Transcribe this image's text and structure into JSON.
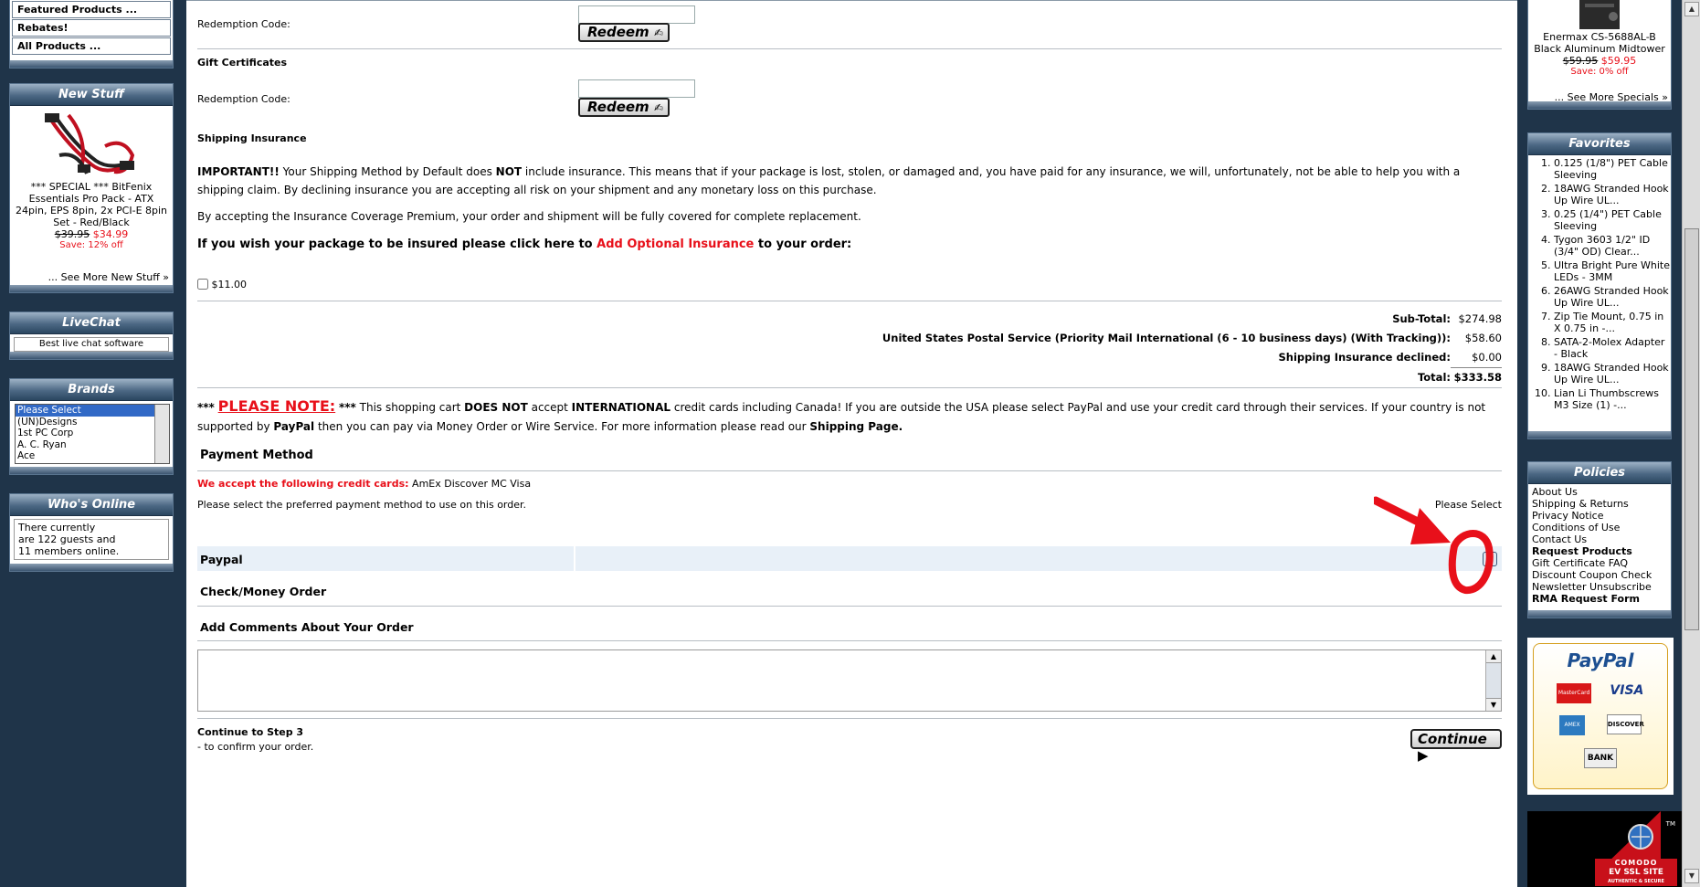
{
  "left": {
    "featured_items": [
      "Featured Products ...",
      "Rebates!",
      "All Products ..."
    ],
    "new_stuff": {
      "title": "New Stuff",
      "image_icon": "cable-kit-image",
      "product": "*** SPECIAL *** BitFenix Essentials Pro Pack - ATX 24pin, EPS 8pin, 2x PCI-E 8pin Set - Red/Black",
      "old_price": "$39.95",
      "new_price": "$34.99",
      "save": "Save: 12% off",
      "more": "... See More New Stuff »"
    },
    "livechat": {
      "title": "LiveChat",
      "text": "Best live chat software"
    },
    "brands": {
      "title": "Brands",
      "options": [
        "Please Select",
        "(UN)Designs",
        "1st PC Corp",
        "A. C. Ryan",
        "Ace"
      ]
    },
    "whos_online": {
      "title": "Who's Online",
      "text": [
        "There currently",
        "are 122 guests and",
        "11 members online."
      ]
    }
  },
  "main": {
    "redemption_label": "Redemption Code:",
    "redeem_label": "Redeem",
    "gift_certificates": "Gift Certificates",
    "shipping_insurance": "Shipping Insurance",
    "important_prefix": "IMPORTANT!!",
    "important_a": "  Your Shipping Method by Default does ",
    "important_not": "NOT",
    "important_b": " include insurance. This means that if your package is lost, stolen, or damaged and, you have paid for any insurance, we will, unfortunately, not be able to help you with a shipping claim. By declining insurance you are accepting all risk on your shipment and any monetary loss on this purchase.",
    "accepting": "By accepting the Insurance Coverage Premium, your order and shipment will be fully covered for complete replacement.",
    "insure_a": "If you wish your package to be insured please click here to ",
    "insure_link": "Add Optional Insurance",
    "insure_b": " to your order:",
    "insurance_price": "$11.00",
    "totals": [
      {
        "label": "Sub-Total:",
        "value": "$274.98"
      },
      {
        "label": "United States Postal Service (Priority Mail International (6 - 10 business days) (With Tracking)):",
        "value": "$58.60"
      },
      {
        "label": "Shipping Insurance declined:",
        "value": "$0.00"
      },
      {
        "label": "Total:",
        "value": "$333.58"
      }
    ],
    "note_stars": "***",
    "note_title": "PLEASE NOTE:",
    "note_a": " This shopping cart ",
    "note_not": "DOES NOT",
    "note_b": " accept ",
    "note_intl": "INTERNATIONAL",
    "note_c": " credit cards including Canada! If you are outside the USA please select PayPal and use your credit card through their services. If your country is not supported by ",
    "note_paypal": "PayPal",
    "note_d": "  then you can pay via Money Order or Wire Service. For more information please read our ",
    "note_link": "Shipping Page.",
    "payment_method": "Payment Method",
    "we_accept": "We accept the following credit cards:",
    "cards": "AmEx Discover MC Visa",
    "select_pref": "Please select the preferred payment method to use on this order.",
    "please_select": "Please Select",
    "paypal": "Paypal",
    "check": "Check/Money Order",
    "comments": "Add Comments About Your Order",
    "continue_step": "Continue to Step 3",
    "confirm": "- to confirm your order.",
    "continue_btn": "Continue"
  },
  "right": {
    "special": {
      "product": "Enermax CS-5688AL-B Black Aluminum Midtower",
      "old_price": "$59.95",
      "new_price": "$59.95",
      "save": "Save: 0% off",
      "more": "... See More Specials »"
    },
    "favorites": {
      "title": "Favorites",
      "items": [
        "0.125 (1/8\") PET Cable Sleeving",
        "18AWG Stranded Hook Up Wire UL...",
        "0.25 (1/4\") PET Cable Sleeving",
        "Tygon 3603 1/2\" ID (3/4\" OD) Clear...",
        "Ultra Bright Pure White LEDs - 3MM",
        "26AWG Stranded Hook Up Wire UL...",
        "Zip Tie Mount, 0.75 in X 0.75 in -...",
        "SATA-2-Molex Adapter - Black",
        "18AWG Stranded Hook Up Wire UL...",
        "Lian Li Thumbscrews M3 Size (1) -..."
      ]
    },
    "policies": {
      "title": "Policies",
      "links": [
        "About Us",
        "Shipping & Returns",
        "Privacy Notice",
        "Conditions of Use",
        "Contact Us",
        "Request Products",
        "Gift Certificate FAQ",
        "Discount Coupon Check",
        "Newsletter Unsubscribe",
        "RMA Request Form"
      ]
    },
    "paypal_logo": "PayPal",
    "card_logos": [
      "MasterCard",
      "VISA",
      "AMEX",
      "DISCOVER",
      "BANK"
    ],
    "ssl": {
      "brand": "COMODO",
      "line1": "EV SSL SITE",
      "line2": "AUTHENTIC & SECURE",
      "tm": "TM"
    }
  },
  "colors": {
    "nav_dark": "#1f3449",
    "alert_red": "#e8101a",
    "paypal_blue": "#1d4f91"
  }
}
